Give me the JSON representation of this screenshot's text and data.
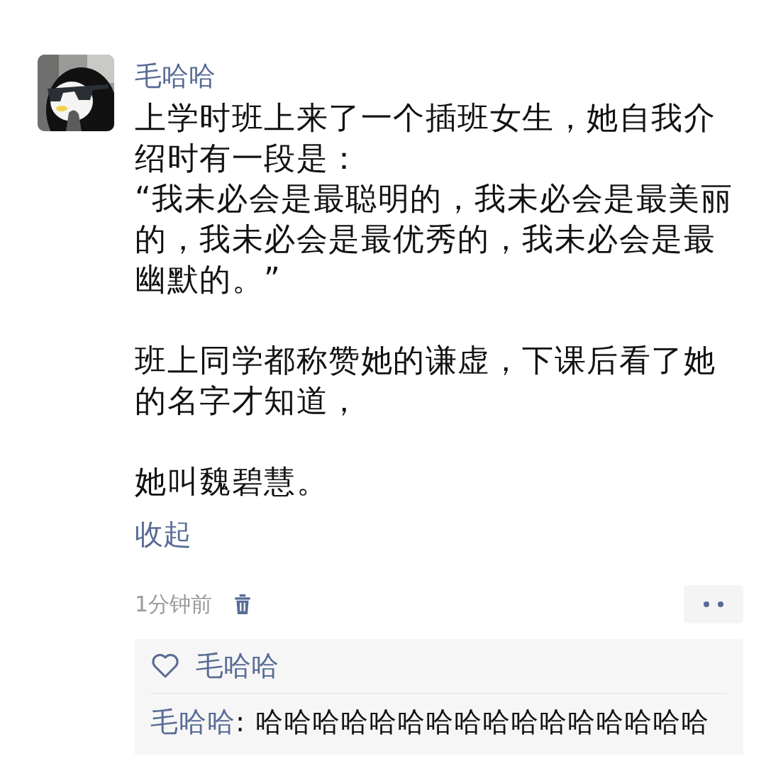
{
  "post": {
    "author": "毛哈哈",
    "paragraph_groups": [
      [
        "上学时班上来了一个插班女生，她自我介绍时有一段是：",
        "“我未必会是最聪明的，我未必会是最美丽的，我未必会是最优秀的，我未必会是最幽默的。”"
      ],
      [
        "班上同学都称赞她的谦虚，下课后看了她的名字才知道，"
      ],
      [
        "她叫魏碧慧。"
      ]
    ],
    "collapse_link": "收起",
    "time": "1分钟前"
  },
  "likes": [
    "毛哈哈"
  ],
  "comments": [
    {
      "author": "毛哈哈",
      "text": ": 哈哈哈哈哈哈哈哈哈哈哈哈哈哈哈哈"
    }
  ]
}
